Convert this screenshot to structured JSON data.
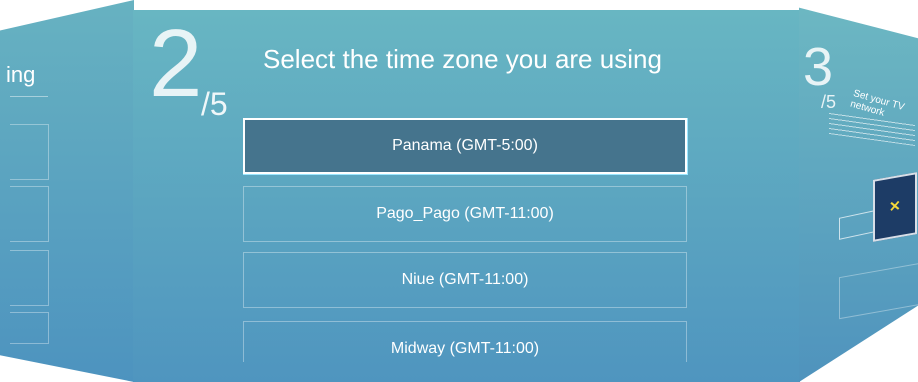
{
  "left_panel": {
    "title_fragment": "ing"
  },
  "main": {
    "step_number": "2",
    "step_total": "/5",
    "title": "Select the time zone you are using",
    "timezones": [
      {
        "label": "Panama  (GMT-5:00)",
        "selected": true
      },
      {
        "label": "Pago_Pago  (GMT-11:00)",
        "selected": false
      },
      {
        "label": "Niue  (GMT-11:00)",
        "selected": false
      },
      {
        "label": "Midway  (GMT-11:00)",
        "selected": false
      }
    ]
  },
  "right_panel": {
    "step_number": "3",
    "step_total": "/5",
    "title": "Set your TV network"
  },
  "colors": {
    "panel_top": "#68b6c2",
    "panel_bottom": "#4f95bf",
    "selected_item": "#45748d",
    "focus_glow": "#9be6ff"
  }
}
